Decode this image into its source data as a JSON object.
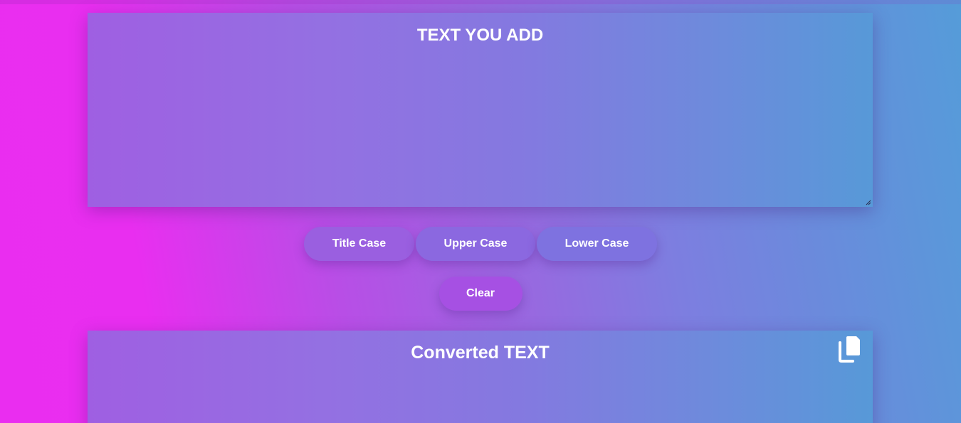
{
  "input_panel": {
    "title": "TEXT YOU ADD",
    "value": ""
  },
  "buttons": {
    "title_case": "Title Case",
    "upper_case": "Upper Case",
    "lower_case": "Lower Case",
    "clear": "Clear"
  },
  "output_panel": {
    "title": "Converted TEXT",
    "copy_icon": "copy-icon"
  }
}
